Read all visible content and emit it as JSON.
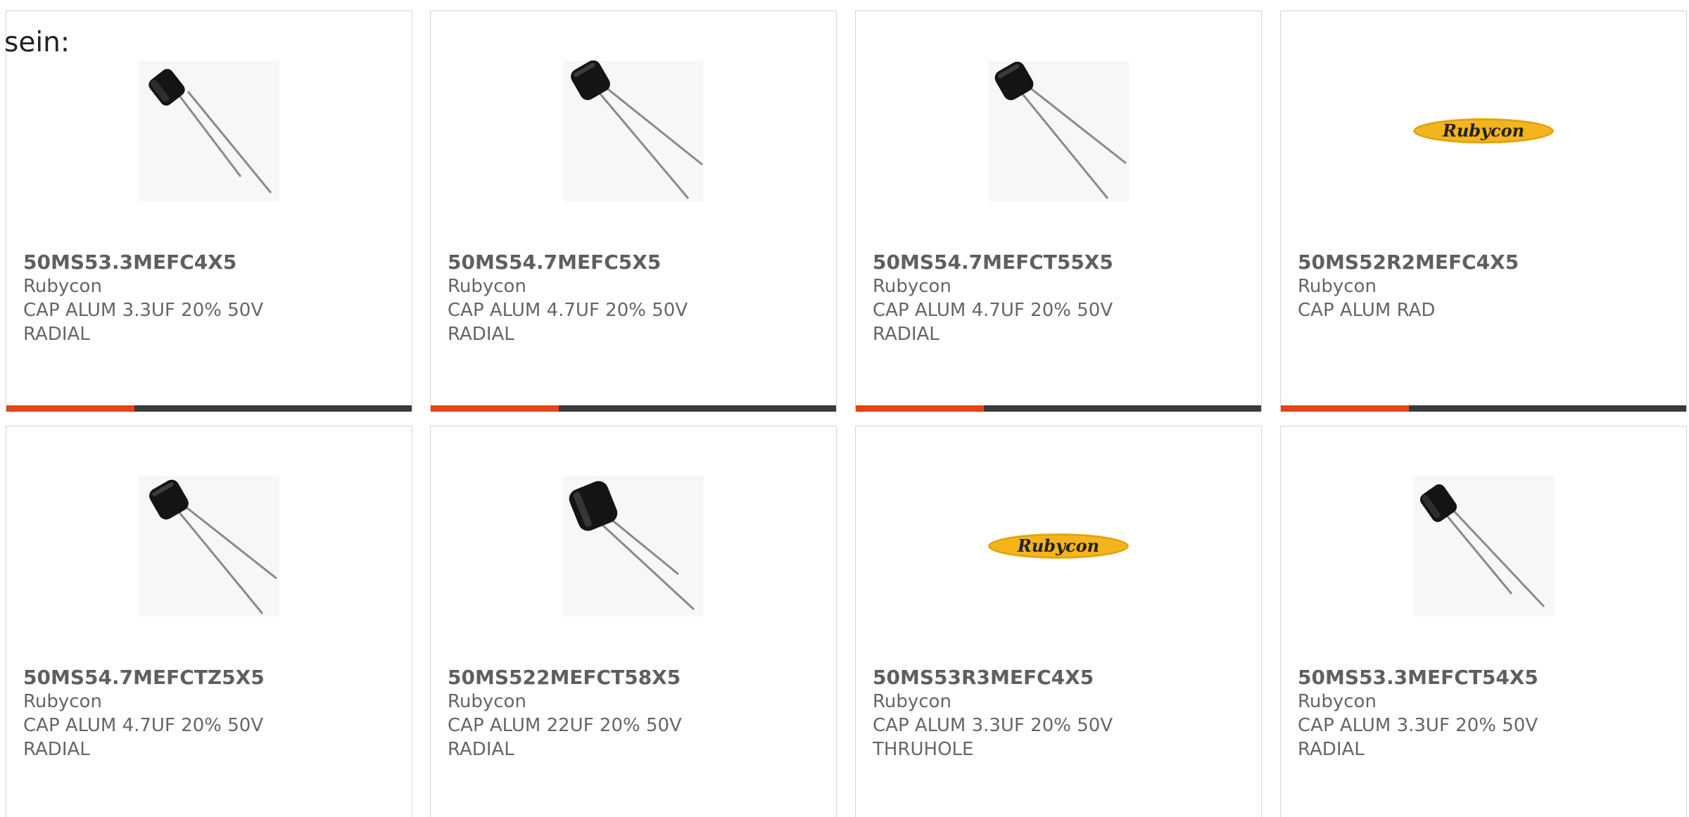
{
  "heading": "sein:",
  "colors": {
    "accent": "#e8421a",
    "bar": "#3a3a3a",
    "border": "#d6d6d6",
    "logo_yellow": "#f3b41c"
  },
  "products": [
    {
      "part": "50MS53.3MEFC4X5",
      "brand": "Rubycon",
      "desc": "CAP ALUM 3.3UF 20% 50V",
      "package": "RADIAL",
      "image": "capacitor-photo"
    },
    {
      "part": "50MS54.7MEFC5X5",
      "brand": "Rubycon",
      "desc": "CAP ALUM 4.7UF 20% 50V",
      "package": "RADIAL",
      "image": "capacitor-photo"
    },
    {
      "part": "50MS54.7MEFCT55X5",
      "brand": "Rubycon",
      "desc": "CAP ALUM 4.7UF 20% 50V",
      "package": "RADIAL",
      "image": "capacitor-photo"
    },
    {
      "part": "50MS52R2MEFC4X5",
      "brand": "Rubycon",
      "desc": "CAP ALUM RAD",
      "package": "",
      "image": "rubycon-logo",
      "logo_text": "Rubycon"
    },
    {
      "part": "50MS54.7MEFCTZ5X5",
      "brand": "Rubycon",
      "desc": "CAP ALUM 4.7UF 20% 50V",
      "package": "RADIAL",
      "image": "capacitor-photo"
    },
    {
      "part": "50MS522MEFCT58X5",
      "brand": "Rubycon",
      "desc": "CAP ALUM 22UF 20% 50V",
      "package": "RADIAL",
      "image": "capacitor-photo"
    },
    {
      "part": "50MS53R3MEFC4X5",
      "brand": "Rubycon",
      "desc": "CAP ALUM 3.3UF 20% 50V",
      "package": "THRUHOLE",
      "image": "rubycon-logo",
      "logo_text": "Rubycon"
    },
    {
      "part": "50MS53.3MEFCT54X5",
      "brand": "Rubycon",
      "desc": "CAP ALUM 3.3UF 20% 50V",
      "package": "RADIAL",
      "image": "capacitor-photo"
    }
  ]
}
